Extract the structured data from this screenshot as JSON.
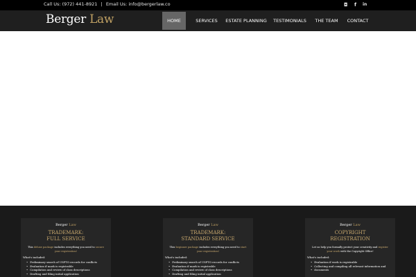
{
  "topbar": {
    "phone_text": "Call Us: (972) 441-8921",
    "separator": "|",
    "email_text": "Email Us: info@bergerlaw.co",
    "icons": [
      "instagram-icon",
      "facebook-icon",
      "linkedin-icon"
    ],
    "instagram_glyph": "◘",
    "facebook_glyph": "f",
    "linkedin_glyph": "in"
  },
  "header": {
    "logo_word1": "Berger",
    "logo_word2": "Law",
    "nav": [
      {
        "label": "HOME",
        "active": true
      },
      {
        "label": "SERVICES"
      },
      {
        "label": "ESTATE PLANNING"
      },
      {
        "label": "TESTIMONIALS"
      },
      {
        "label": "THE TEAM"
      },
      {
        "label": "CONTACT"
      }
    ]
  },
  "colors": {
    "topbar_bg": "#000000",
    "navbar_bg": "#1f1f1f",
    "nav_active_bg": "#666666",
    "gold": "#bfa063",
    "card_bg": "#262626",
    "section_bg": "#1a1a1a"
  },
  "cards": [
    {
      "logo_word1": "Berger",
      "logo_word2": "Law",
      "title_line1": "TRADEMARK:",
      "title_line2": "FULL SERVICE",
      "desc_before": "This ",
      "desc_highlight1": "deluxe package",
      "desc_middle": " includes everything you need to ",
      "desc_highlight2": "secure your registration!",
      "included_label": "What's included:",
      "items": [
        "Preliminary search of USPTO records for conflicts",
        "Evaluation if mark is registrable",
        "Compilation and review of class descriptions",
        "Drafting and filing initial application"
      ]
    },
    {
      "logo_word1": "Berger",
      "logo_word2": "Law",
      "title_line1": "TRADEMARK:",
      "title_line2": "STANDARD SERVICE",
      "desc_before": "This ",
      "desc_highlight1": "beginner package",
      "desc_middle": " includes everything you need to ",
      "desc_highlight2": "start your registration!",
      "included_label": "What's included:",
      "items": [
        "Preliminary search of USPTO records for conflicts",
        "Evaluation if mark is registrable",
        "Compilation and review of class descriptions",
        "Drafting and filing initial application"
      ]
    },
    {
      "logo_word1": "Berger",
      "logo_word2": "Law",
      "title_line1": "COPYRIGHT",
      "title_line2": "REGISTRATION",
      "desc_before": "Let us help you formally protect your creativity and ",
      "desc_highlight1": "register your work",
      "desc_middle": " with the Copyright Office!",
      "desc_highlight2": "",
      "included_label": "What's included:",
      "items": [
        "Evaluation if work is registrable",
        "Collecting and compiling all relevant information and",
        "documents"
      ]
    }
  ]
}
